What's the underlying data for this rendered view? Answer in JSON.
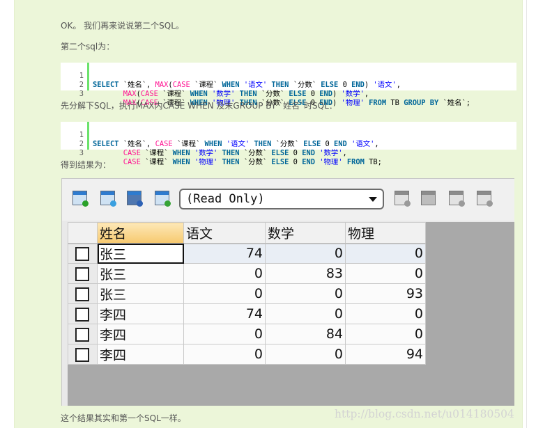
{
  "paragraphs": {
    "p1": "OK。 我们再来说说第二个SQL。",
    "p2": "第二个sql为：",
    "p3": "先分解下SQL，执行MAX内CASE WHEN 及末GROUP BY `姓名`时SQL：",
    "p4": "得到结果为：",
    "p5": "这个结果其实和第一个SQL一样。"
  },
  "code1": {
    "line_numbers": [
      "1",
      "2",
      "3"
    ]
  },
  "code2": {
    "line_numbers": [
      "1",
      "2",
      "3"
    ]
  },
  "toolbar": {
    "mode_select_value": "(Read Only)",
    "icons_left": [
      "grid-add-icon",
      "grid-refresh-icon",
      "grid-export-icon",
      "grid-filter-icon"
    ],
    "icons_right": [
      "record-add-icon",
      "save-icon",
      "record-remove-icon",
      "record-cancel-icon"
    ]
  },
  "grid": {
    "columns": [
      "姓名",
      "语文",
      "数学",
      "物理"
    ],
    "rows": [
      {
        "name": "张三",
        "yuwen": "74",
        "shuxue": "0",
        "wuli": "0"
      },
      {
        "name": "张三",
        "yuwen": "0",
        "shuxue": "83",
        "wuli": "0"
      },
      {
        "name": "张三",
        "yuwen": "0",
        "shuxue": "0",
        "wuli": "93"
      },
      {
        "name": "李四",
        "yuwen": "74",
        "shuxue": "0",
        "wuli": "0"
      },
      {
        "name": "李四",
        "yuwen": "0",
        "shuxue": "84",
        "wuli": "0"
      },
      {
        "name": "李四",
        "yuwen": "0",
        "shuxue": "0",
        "wuli": "94"
      }
    ]
  },
  "watermark": "http://blog.csdn.net/u014180504",
  "colors": {
    "page_panel": "#ecf6d9",
    "keyword": "#006699",
    "function": "#ff1493",
    "string": "#0000ff",
    "gutter_bar": "#6ce26c"
  }
}
